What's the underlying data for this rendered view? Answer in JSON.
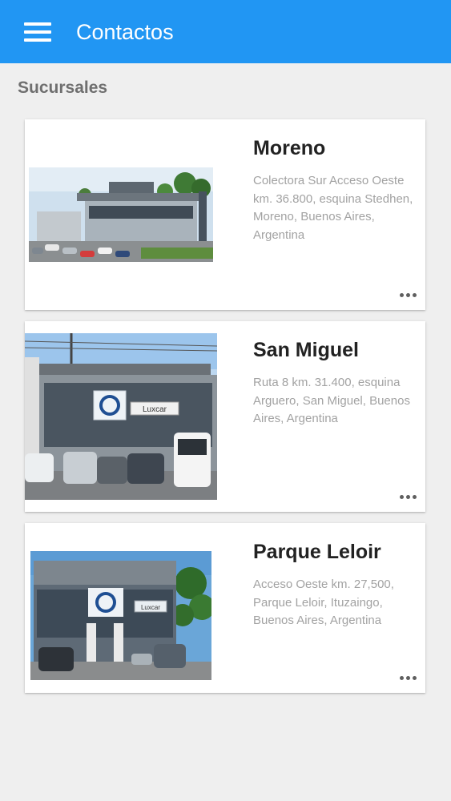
{
  "app_bar": {
    "title": "Contactos",
    "menu_icon": "hamburger-menu-icon",
    "color": "#2196f3"
  },
  "section": {
    "title": "Sucursales"
  },
  "branches": [
    {
      "name": "Moreno",
      "address": "Colectora Sur Acceso Oeste km. 36.800, esquina Stedhen, Moreno, Buenos Aires, Argentina",
      "photo": "dealership-building-photo"
    },
    {
      "name": "San Miguel",
      "address": "Ruta 8 km. 31.400, esquina Arguero, San Miguel, Buenos Aires, Argentina",
      "photo": "dealership-building-photo",
      "sign_text": "Luxcar"
    },
    {
      "name": "Parque Leloir",
      "address": "Acceso Oeste km. 27,500, Parque Leloir, Ituzaingo, Buenos Aires, Argentina",
      "photo": "dealership-building-photo",
      "sign_text": "Luxcar"
    }
  ],
  "overflow_icon": "more-horizontal-icon"
}
